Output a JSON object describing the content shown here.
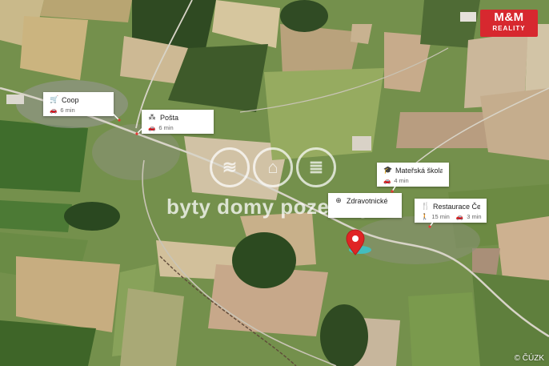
{
  "brand": {
    "logo": "M&M",
    "sub": "REALITY"
  },
  "watermark": {
    "text": "byty domy pozemky",
    "icons": [
      "swirl-icon",
      "house-icon",
      "layers-icon"
    ]
  },
  "attribution": "© ČÚZK",
  "pois": [
    {
      "name": "Coop",
      "category_icon": "shopping-cart-icon",
      "walk": "",
      "drive": "6 min"
    },
    {
      "name": "Pošta",
      "category_icon": "people-icon",
      "walk": "",
      "drive": "6 min"
    },
    {
      "name": "Mateřská škola K...",
      "category_icon": "graduation-cap-icon",
      "walk": "",
      "drive": "4 min"
    },
    {
      "name": "Restaurace Český...",
      "category_icon": "fork-knife-icon",
      "walk": "15 min",
      "drive": "3 min"
    },
    {
      "name": "Zdravotnické",
      "category_icon": "medical-icon",
      "walk": "",
      "drive": ""
    }
  ],
  "marker": {
    "label": "property-location"
  }
}
